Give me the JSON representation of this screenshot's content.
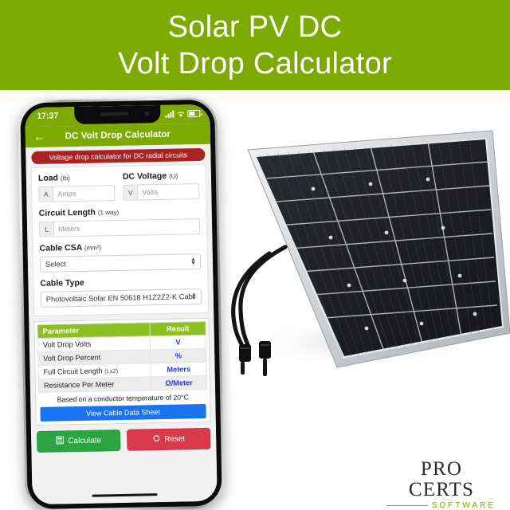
{
  "banner": {
    "line1": "Solar PV DC",
    "line2": "Volt Drop Calculator",
    "background": "#7daa00",
    "text_color": "#ffffff"
  },
  "phone": {
    "status_bar": {
      "time": "17:37",
      "signal_icon": "signal-bars-icon",
      "wifi_icon": "wifi-icon",
      "battery_icon": "battery-icon"
    },
    "app_header": {
      "back_icon": "back-arrow-icon",
      "title": "DC Volt Drop Calculator",
      "background": "#7daa00"
    },
    "badge": {
      "text": "Voltage drop calculator for DC radial circuits",
      "background": "#a82323"
    },
    "form": {
      "load": {
        "label": "Load",
        "sublabel": "(Ib)",
        "prefix": "A",
        "placeholder": "Amps",
        "value": ""
      },
      "dc_voltage": {
        "label": "DC Voltage",
        "sublabel": "(U)",
        "prefix": "V",
        "placeholder": "Volts",
        "value": ""
      },
      "circuit_length": {
        "label": "Circuit Length",
        "sublabel": "(1 way)",
        "prefix": "L",
        "placeholder": "Meters",
        "value": ""
      },
      "cable_csa": {
        "label": "Cable CSA",
        "sublabel": "(mm²)",
        "selected": "Select",
        "chevron_icon": "chevron-updown-icon"
      },
      "cable_type": {
        "label": "Cable Type",
        "sublabel": "",
        "selected": "Photovoltaic Solar EN 50618 H1Z2Z2-K Cab",
        "chevron_icon": "chevron-updown-icon"
      }
    },
    "results": {
      "columns": [
        "Parameter",
        "Result"
      ],
      "rows": [
        {
          "parameter": "Volt Drop Volts",
          "sublabel": "",
          "result": "V"
        },
        {
          "parameter": "Volt Drop Percent",
          "sublabel": "",
          "result": "%"
        },
        {
          "parameter": "Full Circuit Length",
          "sublabel": "(Lx2)",
          "result": "Meters"
        },
        {
          "parameter": "Resistance Per Meter",
          "sublabel": "",
          "result": "Ω/Meter"
        }
      ],
      "note": "Based on a conductor temperature of 20°C",
      "datasheet_button": "View Cable Data Sheet",
      "header_color": "#8cc021",
      "result_color": "#1a35e0",
      "datasheet_color": "#1a73f0"
    },
    "actions": {
      "calculate": {
        "label": "Calculate",
        "icon": "calculator-icon",
        "color": "#2ba443"
      },
      "reset": {
        "label": "Reset",
        "icon": "refresh-icon",
        "color": "#d83a4b"
      }
    }
  },
  "solar_panel": {
    "alt": "monocrystalline solar pv panel with mc4 connector cables",
    "frame_color": "#d5d7da",
    "cell_color": "#15161a",
    "columns": 4,
    "rows": 8
  },
  "logo": {
    "main": "PRO CERTS",
    "sub": "SOFTWARE",
    "sub_color": "#7daa00"
  }
}
